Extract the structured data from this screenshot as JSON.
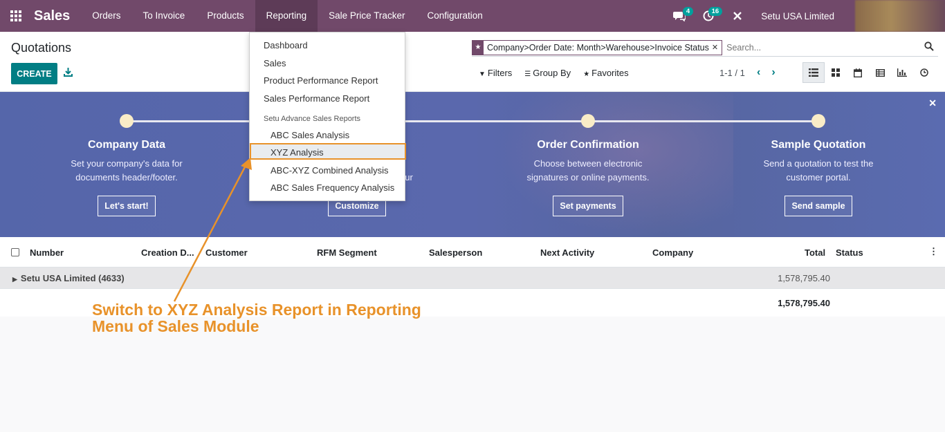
{
  "navbar": {
    "app_name": "Sales",
    "menu": [
      "Orders",
      "To Invoice",
      "Products",
      "Reporting",
      "Sale Price Tracker",
      "Configuration"
    ],
    "active_menu": "Reporting",
    "messages_count": "4",
    "activities_count": "16",
    "company": "Setu USA Limited"
  },
  "control_panel": {
    "title": "Quotations",
    "create_label": "CREATE",
    "facet_label": "Company>Order Date: Month>Warehouse>Invoice Status",
    "search_placeholder": "Search...",
    "filters_label": "Filters",
    "group_by_label": "Group By",
    "favorites_label": "Favorites",
    "pager": "1-1 / 1"
  },
  "dropdown": {
    "items": [
      "Dashboard",
      "Sales",
      "Product Performance Report",
      "Sales Performance Report"
    ],
    "section_header": "Setu Advance Sales Reports",
    "sub_items": [
      "ABC Sales Analysis",
      "XYZ Analysis",
      "ABC-XYZ Combined Analysis",
      "ABC Sales Frequency Analysis"
    ],
    "highlighted": "XYZ Analysis"
  },
  "banner": {
    "steps": [
      {
        "title": "Company Data",
        "desc1": "Set your company's data for",
        "desc2": "documents header/footer.",
        "button": "Let's start!"
      },
      {
        "title": "",
        "desc1": "",
        "desc2": "ur",
        "button": "Customize"
      },
      {
        "title": "Order Confirmation",
        "desc1": "Choose between electronic",
        "desc2": "signatures or online payments.",
        "button": "Set payments"
      },
      {
        "title": "Sample Quotation",
        "desc1": "Send a quotation to test the",
        "desc2": "customer portal.",
        "button": "Send sample"
      }
    ]
  },
  "table": {
    "columns": [
      "Number",
      "Creation D...",
      "Customer",
      "RFM Segment",
      "Salesperson",
      "Next Activity",
      "Company",
      "Total",
      "Status"
    ],
    "group_label": "Setu USA Limited (4633)",
    "group_total": "1,578,795.40",
    "grand_total": "1,578,795.40"
  },
  "annotation": {
    "line1": "Switch to XYZ Analysis Report in Reporting",
    "line2": "Menu of Sales Module",
    "color": "#e8922a"
  },
  "colors": {
    "navbar": "#71496a",
    "primary": "#017e84",
    "banner": "#5a68ad"
  }
}
